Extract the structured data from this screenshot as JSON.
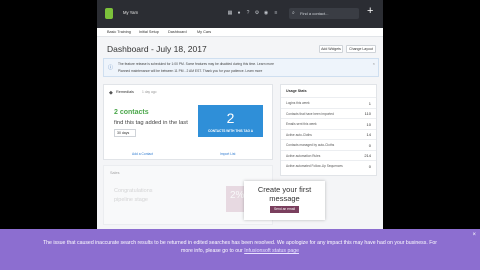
{
  "topbar": {
    "app_title": "My Yarn",
    "search_placeholder": "Find a contact...",
    "plus": "+"
  },
  "subnav": {
    "items": [
      "Basic Training",
      "Initial Setup",
      "Dashboard",
      "My Cars"
    ]
  },
  "page": {
    "title": "Dashboard - July 18, 2017",
    "add_widgets": "Add Widgets",
    "change_layout": "Change Layout"
  },
  "notice": {
    "line1": "The feature release is scheduled for 1:00 PM. Some features may be disabled during this time. Learn more",
    "line2": "Planned maintenance will be between 11 PM - 2 AM EST. Thank you for your patience. Learn more"
  },
  "tag_widget": {
    "title": "Remedials",
    "subtitle": "1 day ago",
    "count_text": "2 contacts",
    "find_text": "find this tag added in the last",
    "select_value": "30 days",
    "box_number": "2",
    "box_label": "CONTACTS WITH THIS TAG A",
    "link_left": "Add a Contact",
    "link_right": "Import List"
  },
  "stats": {
    "title": "Usage Stats",
    "rows": [
      {
        "k": "Logins this week",
        "v": "1"
      },
      {
        "k": "Contacts that have been imported",
        "v": "110"
      },
      {
        "k": "Emails sent this week",
        "v": "10"
      },
      {
        "k": "Active auto-Cloths",
        "v": "14"
      },
      {
        "k": "Contacts managed by auto-Cloths",
        "v": "0"
      },
      {
        "k": "Active automation Rules",
        "v": "214"
      },
      {
        "k": "Active automated Follow-Up Sequences",
        "v": "0"
      }
    ]
  },
  "faded_widget": {
    "title": "Sales",
    "text1": "Congratulations",
    "text2": "pipeline stage",
    "pink_value": "2%"
  },
  "cta": {
    "title": "Create your first message",
    "button": "Send an email"
  },
  "banner": {
    "line1": "The issue that caused inaccurate search results to be returned in edited searches has been resolved. We apologize for any impact this may have had on your business. For",
    "line2": "more info, please go to our",
    "link": "Infusionsoft status page",
    "close": "×"
  }
}
